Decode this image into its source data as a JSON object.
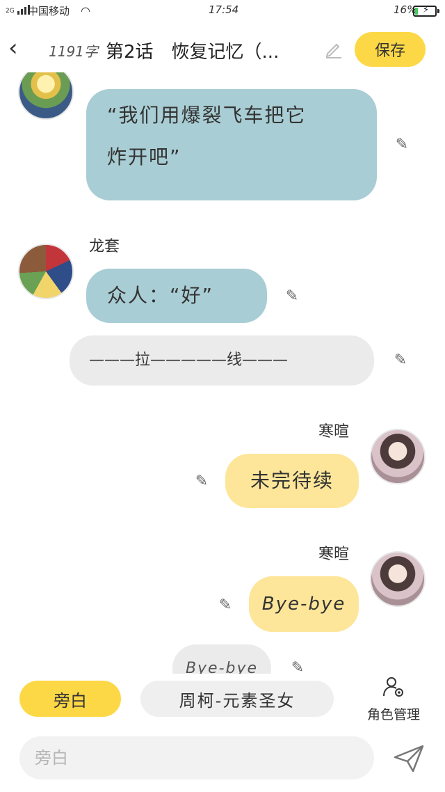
{
  "status": {
    "network": "2G",
    "carrier": "中国移动",
    "time": "17:54",
    "battery": "16%",
    "battery_level": 0.16
  },
  "header": {
    "word_count": "1191字",
    "title": "第2话　恢复记忆（...",
    "save_label": "保存"
  },
  "messages": [
    {
      "type": "left",
      "speaker": "",
      "text_line1": "“我们用爆裂飞车把它",
      "text_line2": "炸开吧”"
    },
    {
      "type": "left",
      "speaker": "龙套",
      "text": "众人：“好”"
    },
    {
      "type": "narration",
      "text": "———拉—————线———"
    },
    {
      "type": "right",
      "speaker": "寒暄",
      "text": "未完待续"
    },
    {
      "type": "right",
      "speaker": "寒暄",
      "text": "Bye-bye"
    },
    {
      "type": "narration",
      "text": "Bye-bye"
    }
  ],
  "role_bar": {
    "narration_label": "旁白",
    "character_label": "周柯-元素圣女",
    "manage_label": "角色管理"
  },
  "input": {
    "placeholder": "旁白"
  },
  "colors": {
    "accent": "#fdd846",
    "left_bubble": "#a9cdd4",
    "right_bubble": "#fde69a",
    "narration_bubble": "#ebebeb"
  }
}
